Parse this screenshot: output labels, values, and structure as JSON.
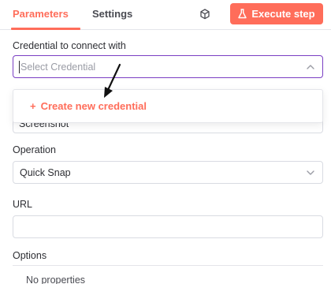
{
  "header": {
    "tabs": [
      {
        "label": "Parameters",
        "active": true
      },
      {
        "label": "Settings",
        "active": false
      }
    ],
    "execute_label": "Execute step",
    "accent": "#ff6d5a"
  },
  "credential": {
    "label": "Credential to connect with",
    "placeholder": "Select Credential",
    "dropdown_option": "Create new credential",
    "obscured_value": "Screenshot"
  },
  "operation": {
    "label": "Operation",
    "value": "Quick Snap"
  },
  "url": {
    "label": "URL",
    "value": ""
  },
  "options": {
    "label": "Options",
    "empty_text": "No properties"
  },
  "icons": [
    "cube-icon",
    "flask-icon",
    "chevron-up-icon",
    "chevron-down-icon",
    "plus-icon",
    "arrow-pointer-icon"
  ]
}
